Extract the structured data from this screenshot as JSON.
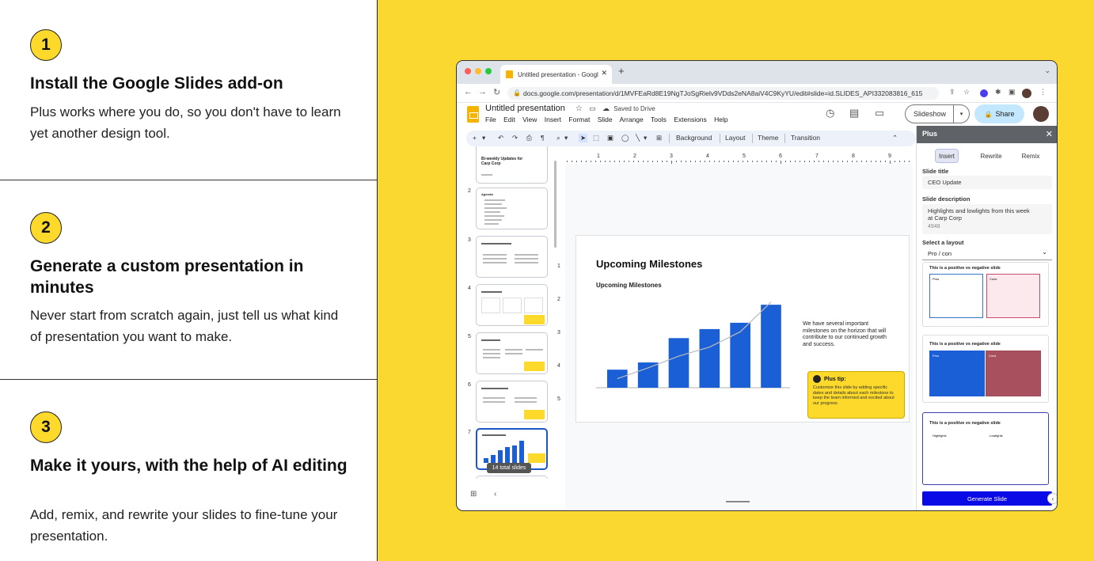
{
  "steps": [
    {
      "num": "1",
      "title": "Install the Google Slides add-on",
      "desc": "Plus works where you do, so you don't have to learn yet another design tool."
    },
    {
      "num": "2",
      "title": "Generate a custom presentation in minutes",
      "desc": "Never start from scratch again, just tell us what kind of presentation you want to make."
    },
    {
      "num": "3",
      "title": "Make it yours, with the help of AI editing",
      "desc": "Add, remix, and rewrite your slides to fine-tune your presentation."
    }
  ],
  "browser": {
    "tab_title": "Untitled presentation - Googl",
    "tab_close": "✕",
    "new_tab": "+",
    "url": "docs.google.com/presentation/d/1MVFEaRd8E19NgTJoSgRielv9VDds2eNA8aiV4C9KyYU/edit#slide=id.SLIDES_API332083816_615"
  },
  "doc": {
    "title": "Untitled presentation",
    "saved": "Saved to Drive",
    "menu": [
      "File",
      "Edit",
      "View",
      "Insert",
      "Format",
      "Slide",
      "Arrange",
      "Tools",
      "Extensions",
      "Help"
    ],
    "slideshow": "Slideshow",
    "share": "Share"
  },
  "toolbar": {
    "background": "Background",
    "layout": "Layout",
    "theme": "Theme",
    "transition": "Transition"
  },
  "thumbnails": {
    "nums": [
      "2",
      "3",
      "4",
      "5",
      "6",
      "7"
    ],
    "first_title": "Bi-weekly Updates for Carp Corp",
    "total": "14 total slides"
  },
  "ruler": [
    "1",
    "2",
    "3",
    "4",
    "5",
    "6",
    "7",
    "8",
    "9"
  ],
  "vruler": [
    "1",
    "2",
    "3",
    "4",
    "5"
  ],
  "slide": {
    "title": "Upcoming Milestones",
    "subtitle": "Upcoming Milestones",
    "text": "We have several important milestones on the horizon that will contribute to our continued growth and success.",
    "tip_title": "Plus tip:",
    "tip_body": "Customize this slide by adding specific dates and details about each milestone to keep the team informed and excited about our progress"
  },
  "chart_data": {
    "type": "bar",
    "categories": [
      "1",
      "2",
      "3",
      "4",
      "5",
      "6"
    ],
    "values": [
      20,
      28,
      55,
      65,
      72,
      92
    ],
    "line": [
      10,
      22,
      35,
      45,
      62,
      95
    ],
    "ylim": [
      0,
      100
    ],
    "bar_color": "#1a5fd6",
    "line_color": "#bbbbbb"
  },
  "panel": {
    "title": "Plus",
    "close": "✕",
    "tabs": [
      "Insert",
      "Rewrite",
      "Remix"
    ],
    "slide_title_label": "Slide title",
    "slide_title_value": "CEO Update",
    "slide_desc_label": "Slide description",
    "slide_desc_value": "Highlights and lowlights from this week at Carp Corp",
    "count": "4948",
    "layout_label": "Select a layout",
    "layout_value": "Pro / con",
    "card_title": "This is a positive vs negative slide",
    "pros": "Pros",
    "cons": "Cons",
    "highlights": "Highlights",
    "lowlights": "Lowlights",
    "generate": "Generate Slide"
  }
}
